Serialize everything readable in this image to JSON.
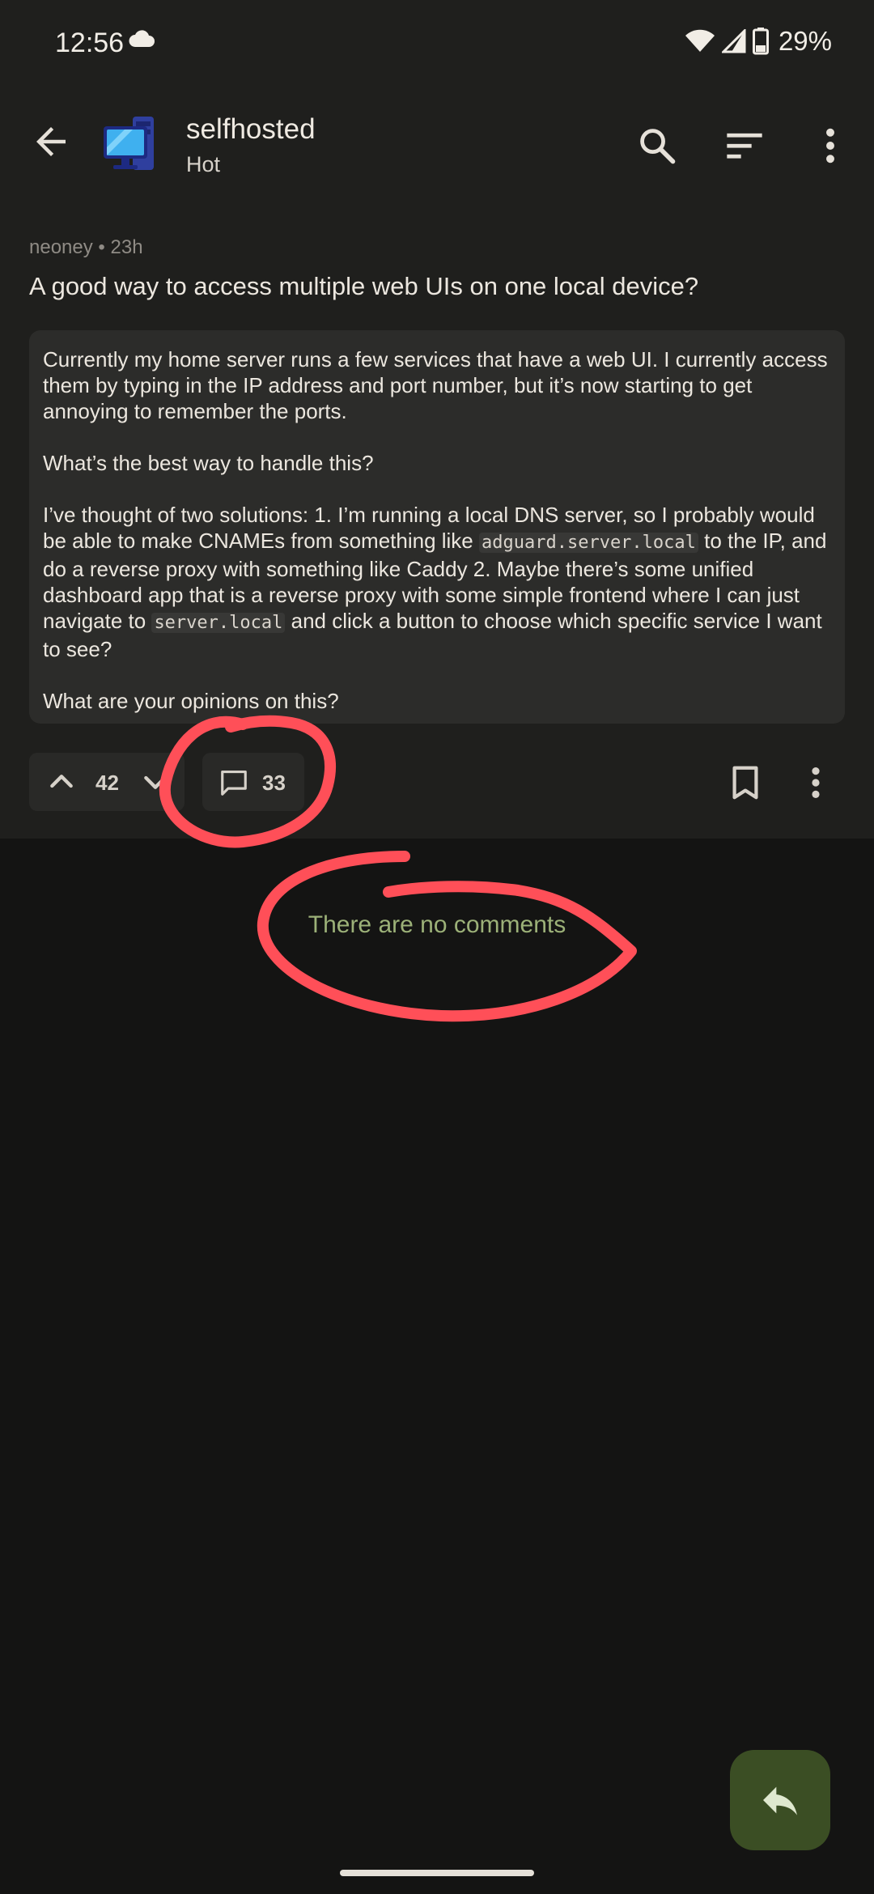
{
  "status_bar": {
    "time": "12:56",
    "battery": "29%"
  },
  "app_bar": {
    "community": "selfhosted",
    "sort": "Hot"
  },
  "post": {
    "author": "neoney",
    "age": "23h",
    "separator": " • ",
    "title": "A good way to access multiple web UIs on one local device?",
    "body": {
      "p1": "Currently my home server runs a few services that have a web UI. I currently access them by typing in the IP address and port number, but it’s now starting to get annoying to remember the ports.",
      "p2": "What’s the best way to handle this?",
      "p3_a": "I’ve thought of two solutions: 1. I’m running a local DNS server, so I probably would be able to make CNAMEs from something like ",
      "p3_code1": "adguard.server.local",
      "p3_b": " to the IP, and do a reverse proxy with something like Caddy 2. Maybe there’s some unified dashboard app that is a reverse proxy with some simple frontend where I can just navigate to ",
      "p3_code2": "server.local",
      "p3_c": " and click a button to choose which specific service I want to see?",
      "p4": "What are your opinions on this?"
    },
    "score": "42",
    "comment_count": "33"
  },
  "comments": {
    "empty_text": "There are no comments"
  },
  "colors": {
    "annotation": "#ff4f58",
    "fab": "#3b4e24",
    "empty_text": "#9cb178"
  }
}
